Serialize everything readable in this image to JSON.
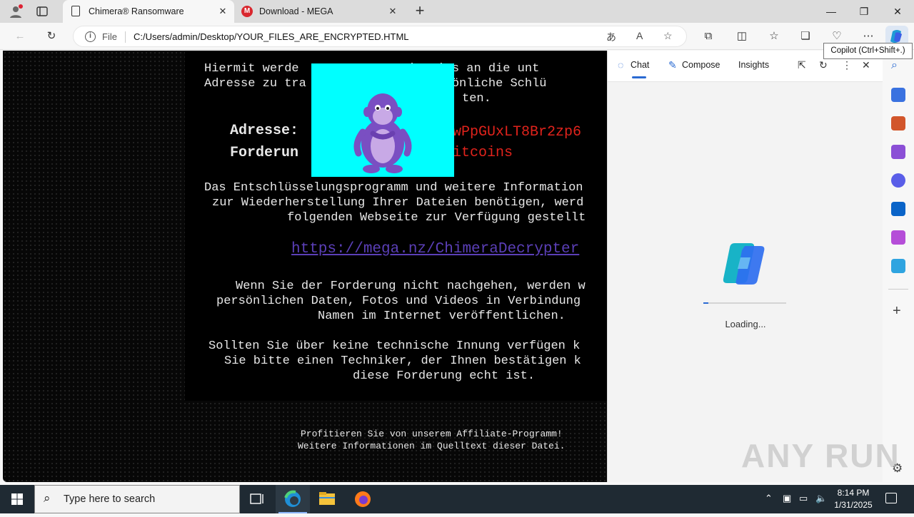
{
  "browser": {
    "tabs": [
      {
        "title": "Chimera® Ransomware",
        "icon": "page-icon",
        "active": true
      },
      {
        "title": "Download - MEGA",
        "icon": "mega-icon",
        "active": false
      }
    ],
    "address": {
      "scheme": "File",
      "url": "C:/Users/admin/Desktop/YOUR_FILES_ARE_ENCRYPTED.HTML"
    },
    "tooltip": "Copilot (Ctrl+Shift+.)"
  },
  "note": {
    "para1_line1": "Hiermit werde              Bitcoins an die unt",
    "para1_line2": "Adresse zu tra              e persönliche Schlü",
    "para1_line3": "               ten.",
    "address_label": "Adresse:",
    "address_value": "wPpGUxLT8Br2zp6",
    "demand_label": "Forderun",
    "demand_value": "itcoins",
    "para2_line1": "Das Entschlüsselungsprogramm und weitere Information",
    "para2_line2": "zur Wiederherstellung Ihrer Dateien benötigen, werd",
    "para2_line3": "folgenden Webseite zur Verfügung gestellt",
    "link": "https://mega.nz/ChimeraDecrypter",
    "para3_line1": "Wenn Sie der Forderung nicht nachgehen, werden w",
    "para3_line2": "persönlichen Daten, Fotos und Videos in Verbindung",
    "para3_line3": "Namen im Internet veröffentlichen.",
    "para4_line1": "Sollten Sie über keine technische Innung verfügen k",
    "para4_line2": "Sie bitte einen Techniker, der Ihnen bestätigen k",
    "para4_line3": "diese Forderung echt ist.",
    "footer_line1": "Profitieren Sie von unserem Affiliate-Programm!",
    "footer_line2": "Weitere Informationen im Quelltext dieser Datei."
  },
  "copilot": {
    "tabs": [
      "Chat",
      "Compose",
      "Insights"
    ],
    "loading_text": "Loading...",
    "progress": 0.06
  },
  "watermark": "ANY RUN",
  "taskbar": {
    "search_placeholder": "Type here to search",
    "time": "8:14 PM",
    "date": "1/31/2025"
  },
  "colors": {
    "ransom_red": "#e0231c",
    "link_purple": "#5b3fb8",
    "bonzi_bg": "#00ffff",
    "taskbar": "#1f2a33"
  }
}
